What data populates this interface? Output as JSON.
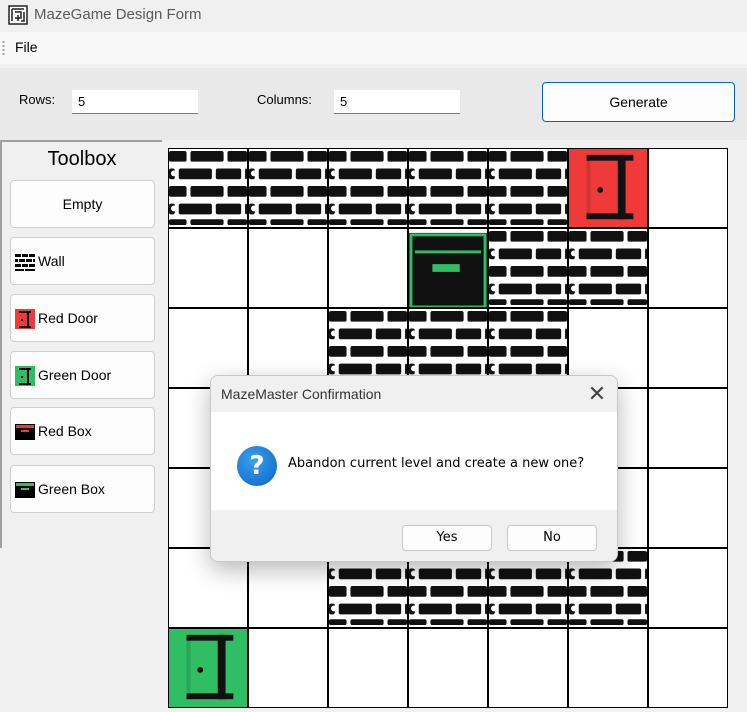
{
  "window": {
    "title": "MazeGame Design Form",
    "icon": "maze-app-icon"
  },
  "menu": {
    "items": [
      {
        "label": "File"
      }
    ]
  },
  "settings": {
    "rows_label": "Rows:",
    "rows_value": "5",
    "columns_label": "Columns:",
    "columns_value": "5",
    "generate_label": "Generate"
  },
  "toolbox": {
    "title": "Toolbox",
    "tools": [
      {
        "label": "Empty",
        "icon": ""
      },
      {
        "label": "Wall",
        "icon": "wall-icon"
      },
      {
        "label": "Red Door",
        "icon": "red-door-icon"
      },
      {
        "label": "Green Door",
        "icon": "green-door-icon"
      },
      {
        "label": "Red Box",
        "icon": "red-box-icon"
      },
      {
        "label": "Green Box",
        "icon": "green-box-icon"
      }
    ]
  },
  "maze": {
    "rows": 7,
    "columns": 7,
    "cells": [
      [
        "wall",
        "wall",
        "wall",
        "wall",
        "wall",
        "red-door",
        "empty"
      ],
      [
        "empty",
        "empty",
        "empty",
        "green-box",
        "wall",
        "wall",
        "empty"
      ],
      [
        "empty",
        "empty",
        "wall",
        "wall",
        "wall",
        "empty",
        "empty"
      ],
      [
        "empty",
        "empty",
        "empty",
        "empty",
        "empty",
        "empty",
        "empty"
      ],
      [
        "empty",
        "empty",
        "empty",
        "empty",
        "empty",
        "empty",
        "empty"
      ],
      [
        "empty",
        "empty",
        "wall",
        "wall",
        "wall",
        "wall",
        "empty"
      ],
      [
        "green-door",
        "empty",
        "empty",
        "empty",
        "empty",
        "empty",
        "empty"
      ]
    ]
  },
  "colors": {
    "red": "#f03a3a",
    "green": "#2fbe63",
    "accent": "#0067c0"
  },
  "dialog": {
    "title": "MazeMaster Confirmation",
    "message": "Abandon current level and create a new one?",
    "icon": "question-icon",
    "yes_label": "Yes",
    "no_label": "No",
    "close_glyph": "✕"
  }
}
